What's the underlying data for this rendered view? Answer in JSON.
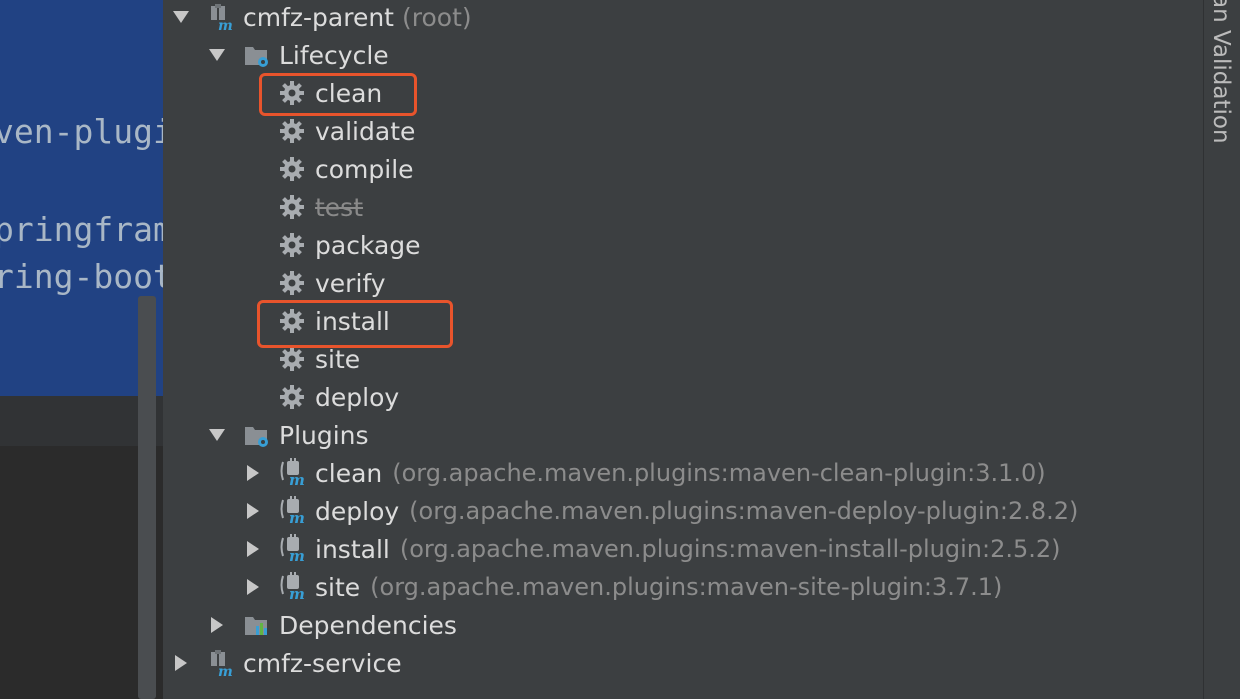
{
  "editor": {
    "lines": [
      "ven-plugi",
      "pringfram",
      "ring-boot"
    ]
  },
  "tree": {
    "root": {
      "label": "cmfz-parent",
      "suffix": "(root)"
    },
    "lifecycle": {
      "label": "Lifecycle",
      "phases": [
        "clean",
        "validate",
        "compile",
        "test",
        "package",
        "verify",
        "install",
        "site",
        "deploy"
      ],
      "skipped_phase": "test",
      "highlighted_phases": [
        "clean",
        "install"
      ]
    },
    "plugins": {
      "label": "Plugins",
      "items": [
        {
          "label": "clean",
          "coords": "(org.apache.maven.plugins:maven-clean-plugin:3.1.0)"
        },
        {
          "label": "deploy",
          "coords": "(org.apache.maven.plugins:maven-deploy-plugin:2.8.2)"
        },
        {
          "label": "install",
          "coords": "(org.apache.maven.plugins:maven-install-plugin:2.5.2)"
        },
        {
          "label": "site",
          "coords": "(org.apache.maven.plugins:maven-site-plugin:3.7.1)"
        }
      ]
    },
    "dependencies": {
      "label": "Dependencies"
    },
    "service": {
      "label": "cmfz-service"
    }
  },
  "right_strip": {
    "label": "an Validation"
  },
  "colors": {
    "panel_bg": "#3c3f41",
    "editor_selection": "#214283",
    "highlight_border": "#e8542c",
    "maven_blue": "#389fd6"
  }
}
